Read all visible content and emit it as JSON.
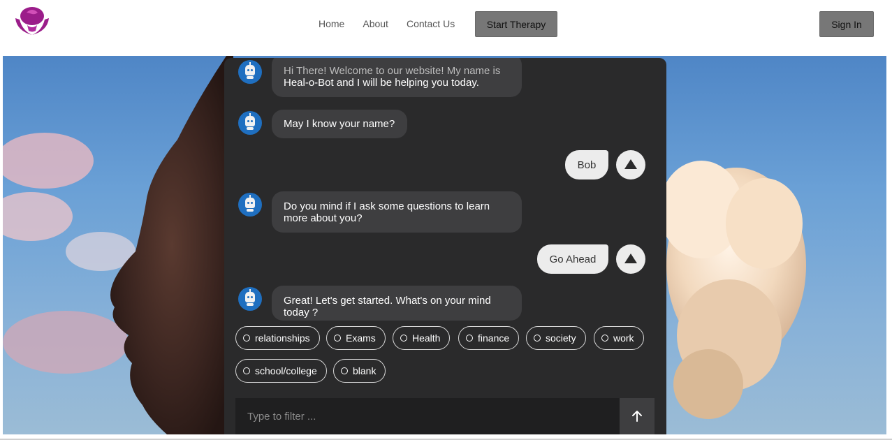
{
  "nav": {
    "logo_icon": "head-in-hands-logo",
    "links": [
      "Home",
      "About",
      "Contact Us"
    ],
    "start_label": "Start Therapy",
    "signin_label": "Sign In"
  },
  "chat": {
    "bot_icon": "robot-icon",
    "user_icon": "user-triangle-icon",
    "messages": [
      {
        "from": "bot",
        "lines": [
          "Hi There! Welcome to our website! My name is",
          "Heal-o-Bot and I will be helping you today."
        ]
      },
      {
        "from": "bot",
        "lines": [
          "May I know your name?"
        ]
      },
      {
        "from": "user",
        "text": "Bob"
      },
      {
        "from": "bot",
        "lines": [
          "Do you mind if I ask some questions to learn",
          "more about you?"
        ]
      },
      {
        "from": "user",
        "text": "Go Ahead"
      },
      {
        "from": "bot",
        "lines": [
          "Great! Let's get started. What's on your mind",
          "today ?"
        ]
      }
    ],
    "options": [
      "relationships",
      "Exams",
      "Health",
      "finance",
      "society",
      "work",
      "school/college",
      "blank"
    ],
    "input_placeholder": "Type to filter ...",
    "send_icon": "arrow-up-icon"
  },
  "colors": {
    "chat_bg": "#2a2a2b",
    "bot_bubble": "#3e3e40",
    "user_bubble": "#ececec",
    "avatar_blue": "#1f6fc0",
    "button_gray": "#777777",
    "logo_magenta": "#9b1d8a"
  }
}
